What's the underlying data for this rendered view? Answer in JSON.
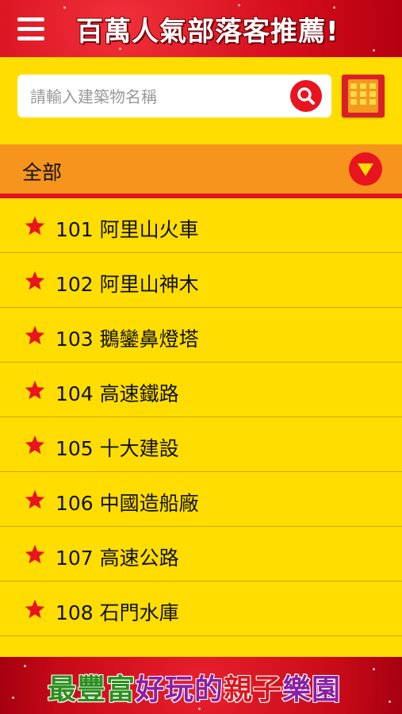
{
  "header": {
    "title": "百萬人氣部落客推薦!",
    "menu_icon": "hamburger-menu-icon"
  },
  "search": {
    "placeholder": "請輸入建築物名稱",
    "value": "",
    "search_icon": "search-icon",
    "grid_icon": "calculator-grid-icon"
  },
  "category": {
    "selected": "全部",
    "dropdown_icon": "triangle-down-icon"
  },
  "list": {
    "items": [
      {
        "label": "101 阿里山火車"
      },
      {
        "label": "102 阿里山神木"
      },
      {
        "label": "103 鵝鑾鼻燈塔"
      },
      {
        "label": "104 高速鐵路"
      },
      {
        "label": "105 十大建設"
      },
      {
        "label": "106 中國造船廠"
      },
      {
        "label": "107 高速公路"
      },
      {
        "label": "108 石門水庫"
      }
    ],
    "item_icon": "star-icon"
  },
  "footer_ad": {
    "part1": "最豐富",
    "part2": "好玩的",
    "part3": "親子",
    "part4": "樂園"
  },
  "colors": {
    "background": "#FFDD00",
    "category_bar": "#F7941D",
    "accent_red": "#E8141F"
  }
}
